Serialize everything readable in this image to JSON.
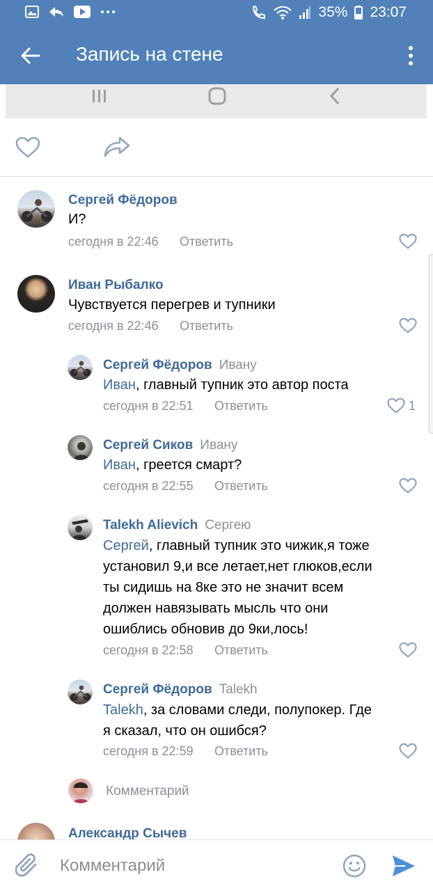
{
  "status_bar": {
    "battery": "35%",
    "time": "23:07"
  },
  "app_bar": {
    "title": "Запись на стене"
  },
  "comments": [
    {
      "author": "Сергей Фёдоров",
      "to": "",
      "mention": "",
      "text": "И?",
      "time": "сегодня в 22:46",
      "reply": "Ответить",
      "likes": ""
    },
    {
      "author": "Иван Рыбалко",
      "to": "",
      "mention": "",
      "text": "Чувствуется перегрев и тупники",
      "time": "сегодня в 22:46",
      "reply": "Ответить",
      "likes": ""
    },
    {
      "author": "Сергей Фёдоров",
      "to": "Ивану",
      "mention": "Иван",
      "text": ", главный тупник это автор поста",
      "time": "сегодня в 22:51",
      "reply": "Ответить",
      "likes": "1"
    },
    {
      "author": "Сергей Сиков",
      "to": "Ивану",
      "mention": "Иван",
      "text": ", греется смарт?",
      "time": "сегодня в 22:55",
      "reply": "Ответить",
      "likes": ""
    },
    {
      "author": "Talekh Alievich",
      "to": "Сергею",
      "mention": "Сергей",
      "text": ", главный тупник это чижик,я тоже",
      "lines": [
        "установил 9,и все летает,нет глюков,если",
        "ты сидишь на 8ке это не значит всем",
        "должен навязывать мысль что они",
        "ошиблись обновив до 9ки,лось!"
      ],
      "time": "сегодня в 22:58",
      "reply": "Ответить",
      "likes": ""
    },
    {
      "author": "Сергей Фёдоров",
      "to": "Talekh",
      "mention": "Talekh",
      "text": ", за словами следи, полупокер. Где",
      "lines": [
        "я сказал, что он ошибся?"
      ],
      "time": "сегодня в 22:59",
      "reply": "Ответить",
      "likes": ""
    }
  ],
  "reply_input": {
    "placeholder": "Комментарий"
  },
  "next_comment": {
    "author": "Александр Сычев"
  },
  "composer": {
    "placeholder": "Комментарий"
  },
  "colors": {
    "header": "#5181b8",
    "link": "#3f6a99",
    "muted": "#8a8f96",
    "send": "#4a90d9"
  }
}
